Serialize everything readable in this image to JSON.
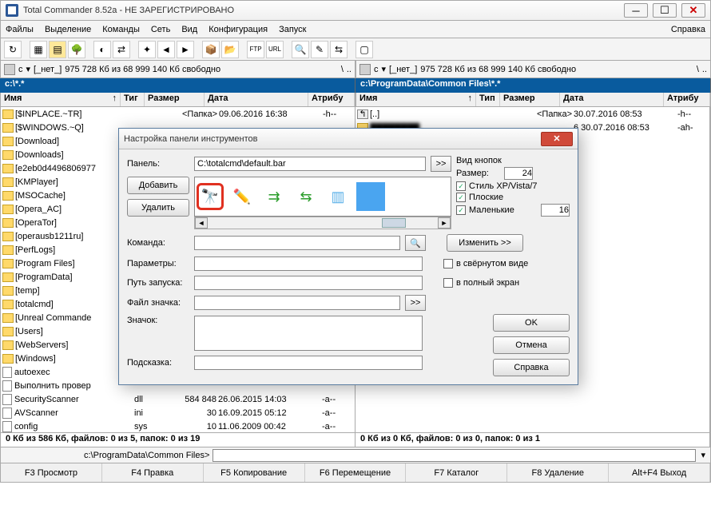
{
  "window": {
    "title": "Total Commander 8.52a - НЕ ЗАРЕГИСТРИРОВАНО"
  },
  "menu": {
    "file": "Файлы",
    "select": "Выделение",
    "commands": "Команды",
    "net": "Сеть",
    "view": "Вид",
    "config": "Конфигурация",
    "start": "Запуск",
    "help": "Справка"
  },
  "drive": {
    "label": "c",
    "vol": "[_нет_]",
    "info": "975 728 Кб из 68 999 140 Кб свободно"
  },
  "left": {
    "path": "c:\\*.*",
    "status": "0 Кб из 586 Кб, файлов: 0 из 5, папок: 0 из 19"
  },
  "right": {
    "path": "c:\\ProgramData\\Common Files\\*.*",
    "status": "0 Кб из 0 Кб, файлов: 0 из 0, папок: 0 из 1",
    "up_ext": "<Папка>",
    "up_date": "30.07.2016 08:53",
    "up_attr": "-h--",
    "row2_date": "6 30.07.2016 08:53",
    "row2_attr": "-ah-"
  },
  "hdr": {
    "name": "Имя",
    "ext": "Тип",
    "size": "Размер",
    "date": "Дата",
    "attr": "Атрибу"
  },
  "left_hdr_ext": "Тиг",
  "files": [
    {
      "name": "[$INPLACE.~TR]",
      "ext": "",
      "size": "<Папка>",
      "date": "09.06.2016 16:38",
      "attr": "-h--"
    },
    {
      "name": "[$WINDOWS.~Q]",
      "ext": "",
      "size": "",
      "date": "",
      "attr": ""
    },
    {
      "name": "[Download]",
      "ext": "",
      "size": "",
      "date": "",
      "attr": ""
    },
    {
      "name": "[Downloads]",
      "ext": "",
      "size": "",
      "date": "",
      "attr": ""
    },
    {
      "name": "[e2eb0d4496806977",
      "ext": "",
      "size": "",
      "date": "",
      "attr": ""
    },
    {
      "name": "[KMPlayer]",
      "ext": "",
      "size": "",
      "date": "",
      "attr": ""
    },
    {
      "name": "[MSOCache]",
      "ext": "",
      "size": "",
      "date": "",
      "attr": ""
    },
    {
      "name": "[Opera_AC]",
      "ext": "",
      "size": "",
      "date": "",
      "attr": ""
    },
    {
      "name": "[OperaTor]",
      "ext": "",
      "size": "",
      "date": "",
      "attr": ""
    },
    {
      "name": "[operausb1211ru]",
      "ext": "",
      "size": "",
      "date": "",
      "attr": ""
    },
    {
      "name": "[PerfLogs]",
      "ext": "",
      "size": "",
      "date": "",
      "attr": ""
    },
    {
      "name": "[Program Files]",
      "ext": "",
      "size": "",
      "date": "",
      "attr": ""
    },
    {
      "name": "[ProgramData]",
      "ext": "",
      "size": "",
      "date": "",
      "attr": ""
    },
    {
      "name": "[temp]",
      "ext": "",
      "size": "",
      "date": "",
      "attr": ""
    },
    {
      "name": "[totalcmd]",
      "ext": "",
      "size": "",
      "date": "",
      "attr": ""
    },
    {
      "name": "[Unreal Commande",
      "ext": "",
      "size": "",
      "date": "",
      "attr": ""
    },
    {
      "name": "[Users]",
      "ext": "",
      "size": "",
      "date": "",
      "attr": ""
    },
    {
      "name": "[WebServers]",
      "ext": "",
      "size": "",
      "date": "",
      "attr": ""
    },
    {
      "name": "[Windows]",
      "ext": "",
      "size": "",
      "date": "",
      "attr": ""
    }
  ],
  "files2": [
    {
      "name": "autoexec",
      "ext": "",
      "size": "",
      "date": "",
      "attr": ""
    },
    {
      "name": "Выполнить провер",
      "ext": "",
      "size": "",
      "date": "",
      "attr": ""
    },
    {
      "name": "SecurityScanner",
      "ext": "dll",
      "size": "584 848",
      "date": "26.06.2015 14:03",
      "attr": "-a--"
    },
    {
      "name": "AVScanner",
      "ext": "ini",
      "size": "30",
      "date": "16.09.2015 05:12",
      "attr": "-a--"
    },
    {
      "name": "config",
      "ext": "sys",
      "size": "10",
      "date": "11.06.2009 00:42",
      "attr": "-a--"
    }
  ],
  "cmdline": {
    "label": "c:\\ProgramData\\Common Files>"
  },
  "fkeys": {
    "f3": "F3 Просмотр",
    "f4": "F4 Правка",
    "f5": "F5 Копирование",
    "f6": "F6 Перемещение",
    "f7": "F7 Каталог",
    "f8": "F8 Удаление",
    "altf4": "Alt+F4 Выход"
  },
  "dialog": {
    "title": "Настройка панели инструментов",
    "panel_label": "Панель:",
    "panel_value": "C:\\totalcmd\\default.bar",
    "add": "Добавить",
    "delete": "Удалить",
    "command_label": "Команда:",
    "params_label": "Параметры:",
    "startpath_label": "Путь запуска:",
    "iconfile_label": "Файл значка:",
    "icon_label": "Значок:",
    "tooltip_label": "Подсказка:",
    "view_label": "Вид кнопок",
    "size_label": "Размер:",
    "size_value": "24",
    "style_xp": "Стиль XP/Vista/7",
    "flat": "Плоские",
    "small": "Маленькие",
    "small_value": "16",
    "change": "Изменить >>",
    "minimized": "в свёрнутом виде",
    "fullscreen": "в полный экран",
    "ok": "OK",
    "cancel": "Отмена",
    "help": "Справка",
    "browse": ">>",
    "search": "🔍"
  }
}
